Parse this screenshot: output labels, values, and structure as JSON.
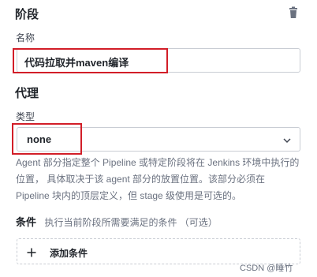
{
  "stage": {
    "title": "阶段",
    "delete_icon": "trash-icon",
    "name_label": "名称",
    "name_value": "代码拉取并maven编译"
  },
  "agent": {
    "title": "代理",
    "type_label": "类型",
    "type_value": "none",
    "dropdown_icon": "chevron-down-icon",
    "help_lines": [
      "Agent 部分指定整个 Pipeline 或特定阶段将在 Jenkins 环境中执行的",
      "位置， 具体取决于该 agent 部分的放置位置。该部分必须在",
      "Pipeline 块内的顶层定义，但 stage 级使用是可选的。"
    ]
  },
  "conditions": {
    "title": "条件",
    "description": "执行当前阶段所需要满足的条件 （可选）",
    "add_label": "添加条件",
    "add_icon": "plus-icon"
  },
  "watermark": "CSDN @睡竹",
  "colors": {
    "highlight": "#d21e28",
    "border": "#c9cdd4"
  }
}
